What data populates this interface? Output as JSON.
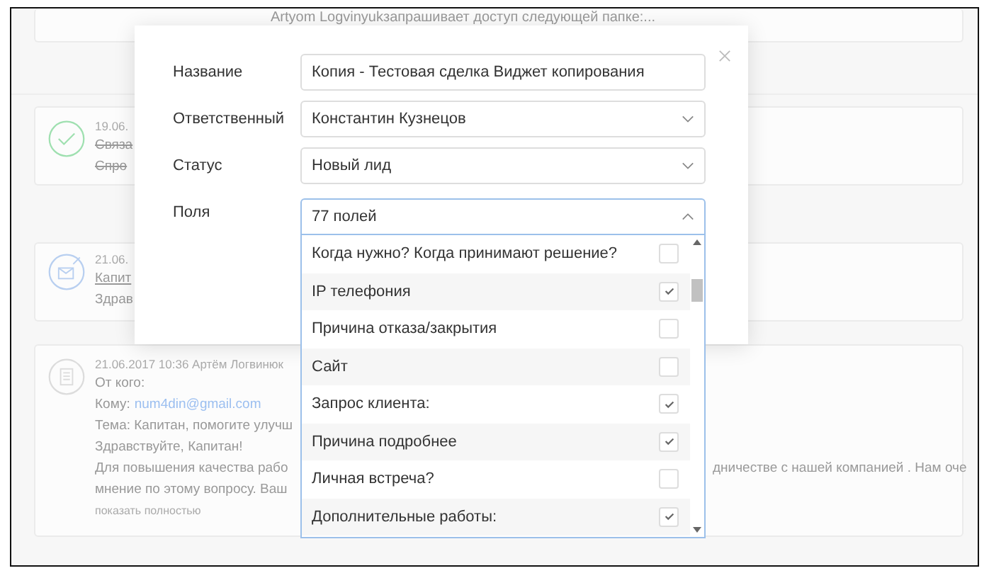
{
  "timeline": [
    {
      "kind": "note",
      "text": "Artyom Logvinyukзапрашивает доступ следующей папке:..."
    },
    {
      "kind": "task",
      "date": "19.06.",
      "lines": [
        "Связа",
        "Спро"
      ],
      "done": true
    },
    {
      "kind": "email",
      "date": "21.06.",
      "subject": "Капит",
      "preview": "Здрав"
    },
    {
      "kind": "message",
      "date": "21.06.2017 10:36 Артём Логвинюк",
      "from_label": "От кого:",
      "to_label": "Кому:",
      "to_email": "num4din@gmail.com",
      "lines": [
        {
          "left": "Тема: Капитан, помогите улучш"
        },
        {
          "left": "Здравствуйте, Капитан!"
        },
        {
          "left": "Для повышения качества рабо",
          "right": "дничестве с нашей компанией . Нам оче"
        },
        {
          "left": "мнение по этому вопросу. Ваш"
        }
      ],
      "more": "показать полностью"
    }
  ],
  "modal": {
    "fields": [
      {
        "label": "Название",
        "kind": "text",
        "value": "Копия - Тестовая сделка Виджет копирования"
      },
      {
        "label": "Ответственный",
        "kind": "select",
        "value": "Константин Кузнецов"
      },
      {
        "label": "Статус",
        "kind": "select",
        "value": "Новый лид"
      },
      {
        "label": "Поля",
        "kind": "multiselect",
        "value": "77 полей",
        "expanded": true,
        "options": [
          {
            "label": "Когда нужно? Когда принимают решение?",
            "checked": false
          },
          {
            "label": "IP телефония",
            "checked": true
          },
          {
            "label": "Причина отказа/закрытия",
            "checked": false
          },
          {
            "label": "Сайт",
            "checked": false
          },
          {
            "label": "Запрос клиента:",
            "checked": true
          },
          {
            "label": "Причина подробнее",
            "checked": true
          },
          {
            "label": "Личная встреча?",
            "checked": false
          },
          {
            "label": "Дополнительные работы:",
            "checked": true
          }
        ]
      }
    ]
  }
}
